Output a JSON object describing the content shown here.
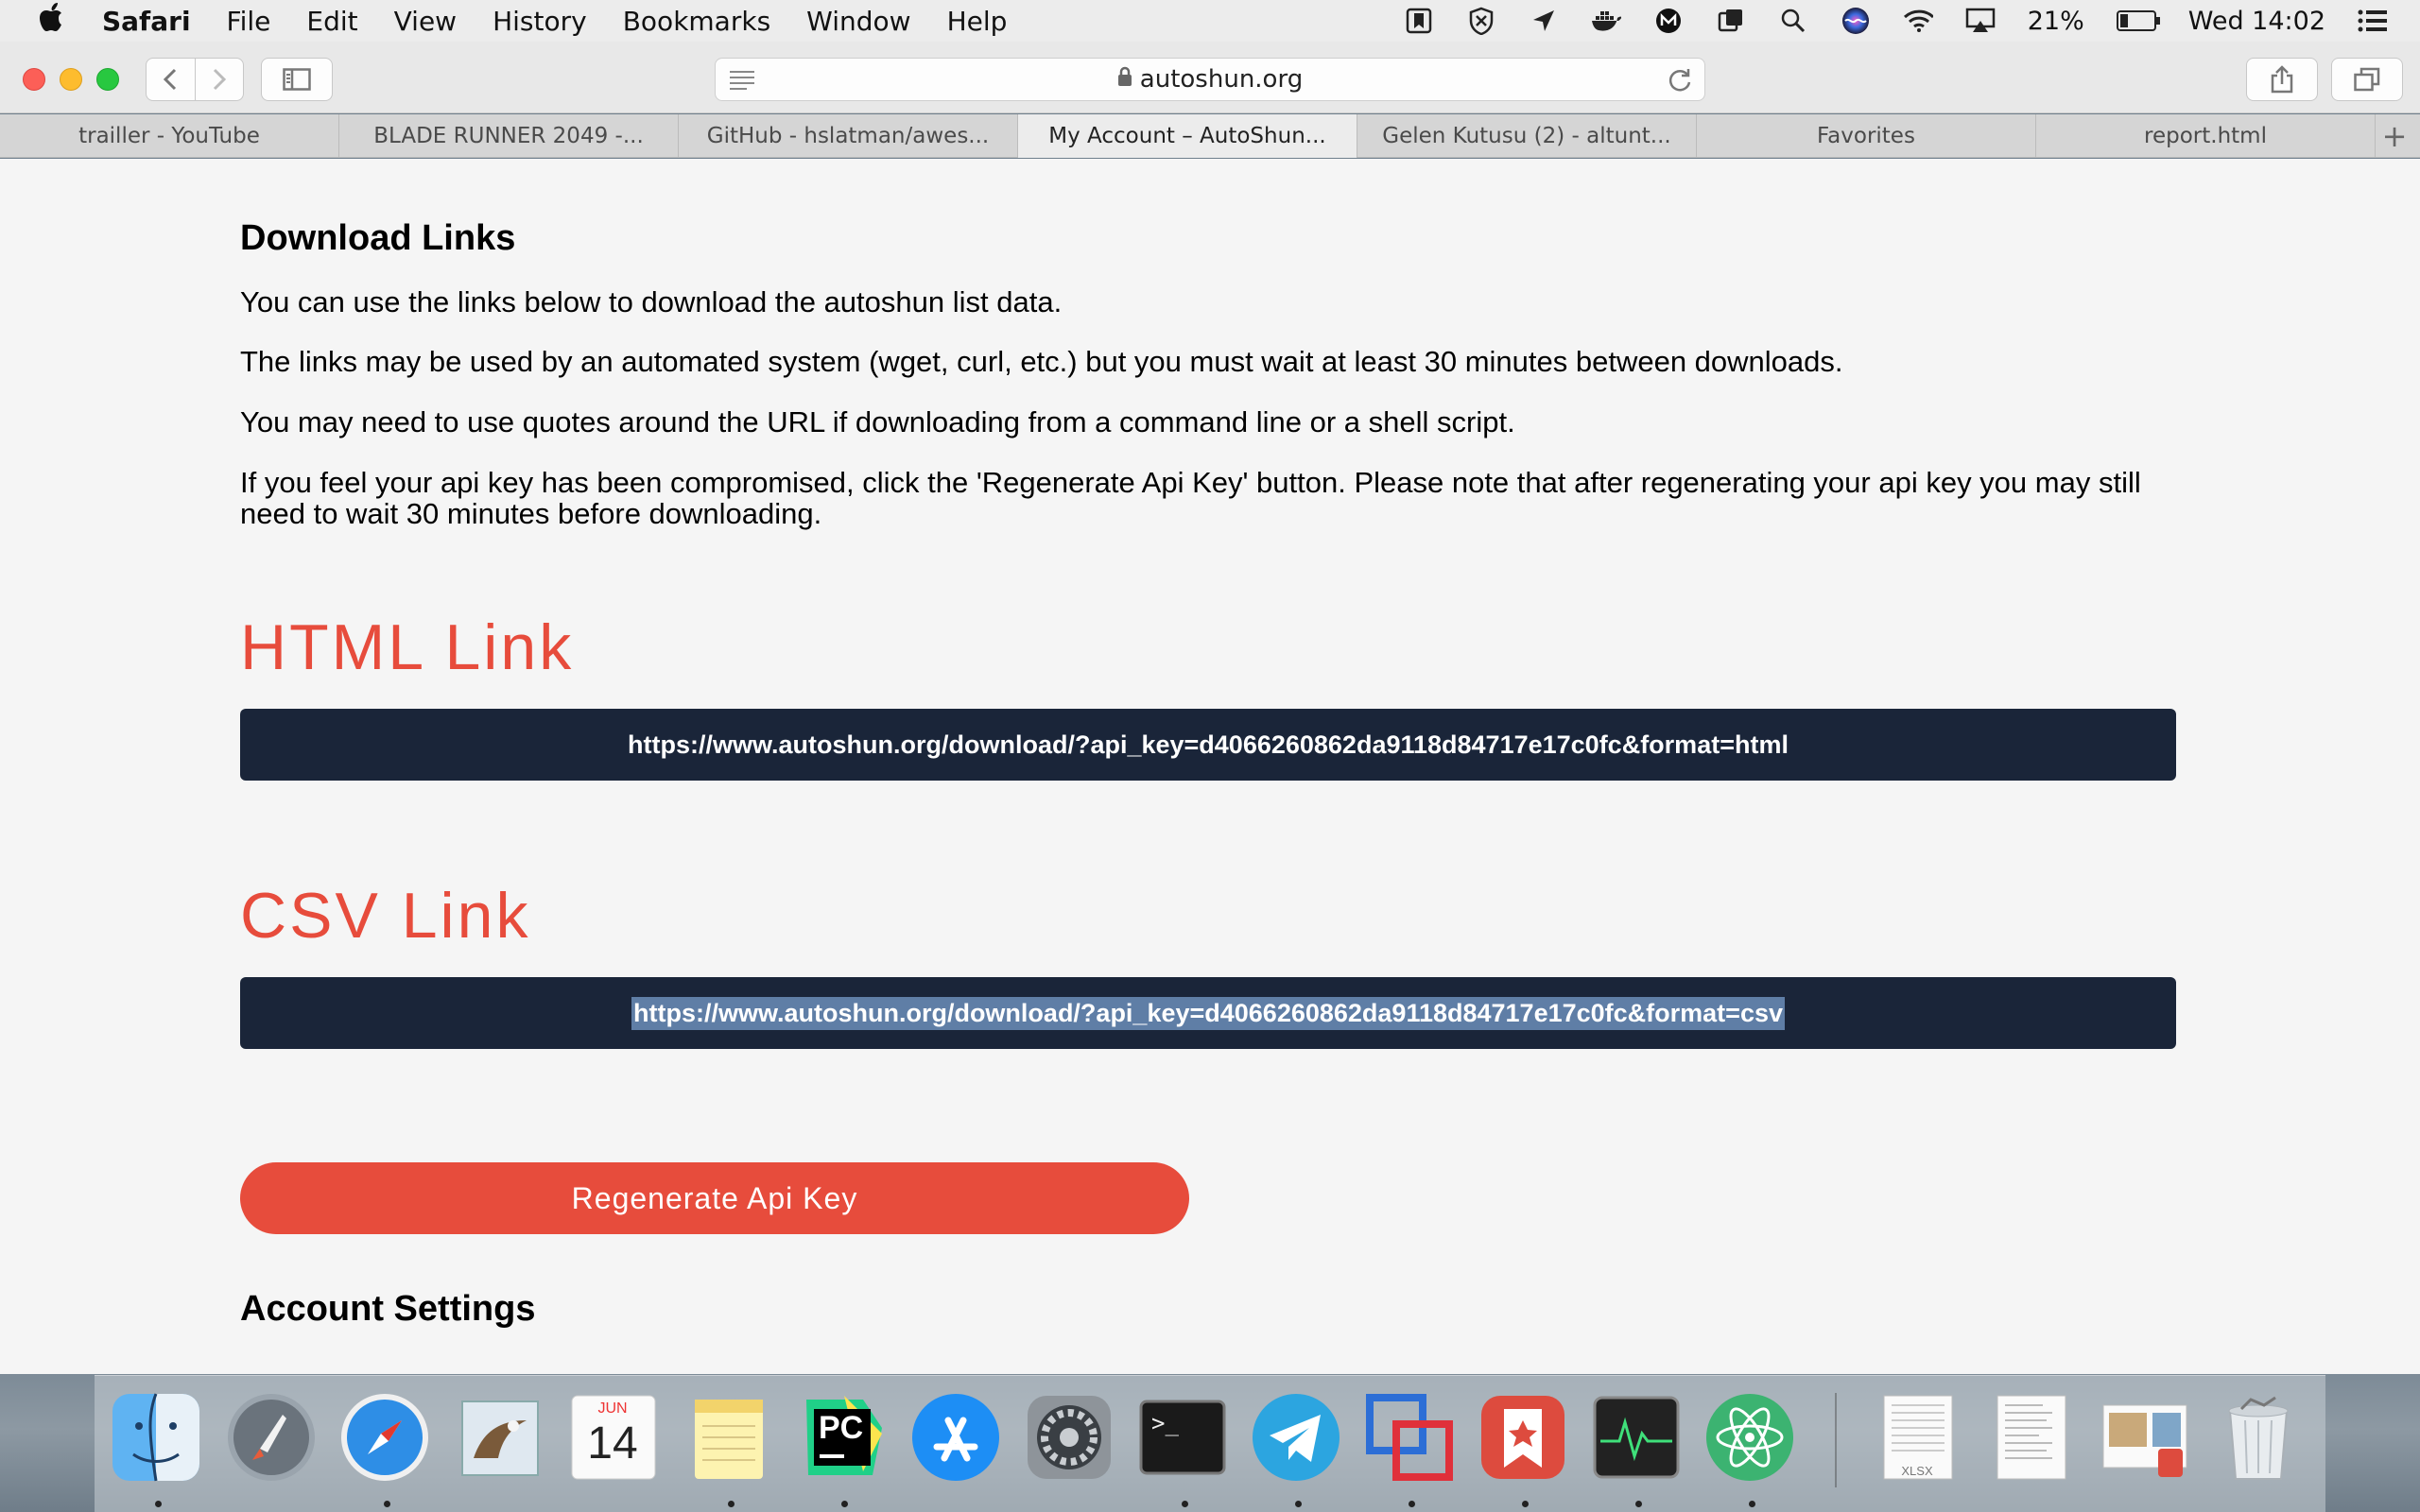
{
  "menubar": {
    "app_name": "Safari",
    "items": [
      "File",
      "Edit",
      "View",
      "History",
      "Bookmarks",
      "Window",
      "Help"
    ],
    "battery_text": "21%",
    "clock": "Wed 14:02"
  },
  "browser": {
    "url": "autoshun.org",
    "tabs": [
      {
        "label": "trailler - YouTube"
      },
      {
        "label": "BLADE RUNNER 2049 -..."
      },
      {
        "label": "GitHub - hslatman/awes..."
      },
      {
        "label": "My Account – AutoShun..."
      },
      {
        "label": "Gelen Kutusu (2) - altunt..."
      },
      {
        "label": "Favorites"
      },
      {
        "label": "report.html"
      }
    ],
    "add_tab": "+"
  },
  "page": {
    "download_heading": "Download Links",
    "para1": "You can use the links below to download the autoshun list data.",
    "para2": "The links may be used by an automated system (wget, curl, etc.) but you must wait at least 30 minutes between downloads.",
    "para3": "You may need to use quotes around the URL if downloading from a command line or a shell script.",
    "para4": "If you feel your api key has been compromised, click the 'Regenerate Api Key' button. Please note that after regenerating your api key you may still need to wait 30 minutes before downloading.",
    "html_heading": "HTML Link",
    "html_url": "https://www.autoshun.org/download/?api_key=d4066260862da9118d84717e17c0fc&format=html",
    "csv_heading": "CSV Link",
    "csv_url": "https://www.autoshun.org/download/?api_key=d4066260862da9118d84717e17c0fc&format=csv",
    "regenerate_label": "Regenerate Api Key",
    "account_heading": "Account Settings"
  },
  "dock": {
    "calendar_month": "JUN",
    "calendar_day": "14",
    "terminal_prompt": ">_",
    "pycharm_label": "PC",
    "xlsx_label": "XLSX"
  },
  "colors": {
    "accent_red": "#e74c3c",
    "link_box_bg": "#1a2539",
    "page_bg": "#f5f5f5"
  }
}
